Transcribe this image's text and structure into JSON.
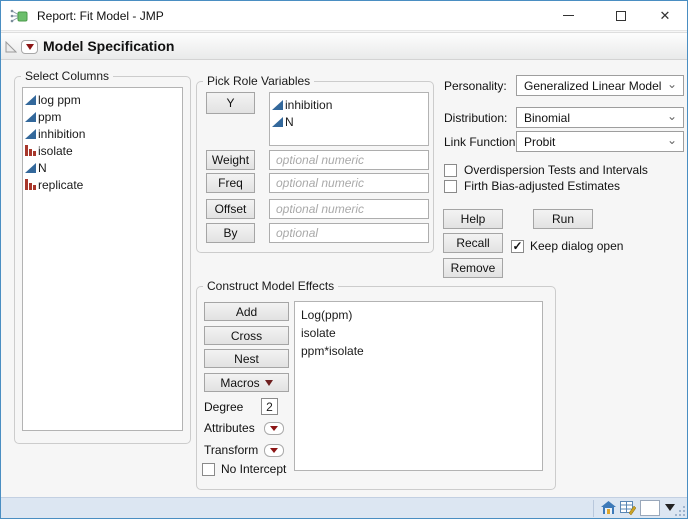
{
  "window": {
    "title": "Report: Fit Model - JMP"
  },
  "icons": {
    "close": "✕",
    "check": "✓",
    "chevron_down": "⌄"
  },
  "outline": {
    "title": "Model Specification"
  },
  "select_columns": {
    "title": "Select Columns",
    "items": [
      {
        "label": "log ppm",
        "type": "continuous"
      },
      {
        "label": "ppm",
        "type": "continuous"
      },
      {
        "label": "inhibition",
        "type": "continuous"
      },
      {
        "label": "isolate",
        "type": "nominal"
      },
      {
        "label": "N",
        "type": "continuous"
      },
      {
        "label": "replicate",
        "type": "nominal"
      }
    ]
  },
  "pick_roles": {
    "title": "Pick Role Variables",
    "y_button": "Y",
    "y_items": [
      {
        "label": "inhibition",
        "type": "continuous"
      },
      {
        "label": "N",
        "type": "continuous"
      }
    ],
    "rows": [
      {
        "button": "Weight",
        "placeholder": "optional numeric"
      },
      {
        "button": "Freq",
        "placeholder": "optional numeric"
      },
      {
        "button": "Offset",
        "placeholder": "optional numeric"
      },
      {
        "button": "By",
        "placeholder": "optional"
      }
    ]
  },
  "personality": {
    "label": "Personality:",
    "value": "Generalized Linear Model"
  },
  "distribution": {
    "label": "Distribution:",
    "value": "Binomial"
  },
  "link_function": {
    "label": "Link Function",
    "value": "Probit"
  },
  "options": {
    "overdispersion": {
      "label": "Overdispersion Tests and Intervals",
      "checked": false
    },
    "firth": {
      "label": "Firth Bias-adjusted Estimates",
      "checked": false
    },
    "keep_dialog": {
      "label": "Keep dialog open",
      "checked": true
    },
    "no_intercept": {
      "label": "No Intercept",
      "checked": false
    }
  },
  "action_buttons": {
    "help": "Help",
    "run": "Run",
    "recall": "Recall",
    "remove": "Remove"
  },
  "model_effects": {
    "title": "Construct Model Effects",
    "buttons": [
      "Add",
      "Cross",
      "Nest"
    ],
    "macros_label": "Macros",
    "degree": {
      "label": "Degree",
      "value": "2"
    },
    "attributes_label": "Attributes",
    "transform_label": "Transform",
    "effects": [
      "Log(ppm)",
      "isolate",
      "ppm*isolate"
    ]
  },
  "colors": {
    "window_border": "#4a8ec2",
    "continuous_icon": "#33689b",
    "nominal_icon": "#a8372b",
    "red_triangle": "#8c1515",
    "statusbar_bg": "#dce6f2"
  }
}
